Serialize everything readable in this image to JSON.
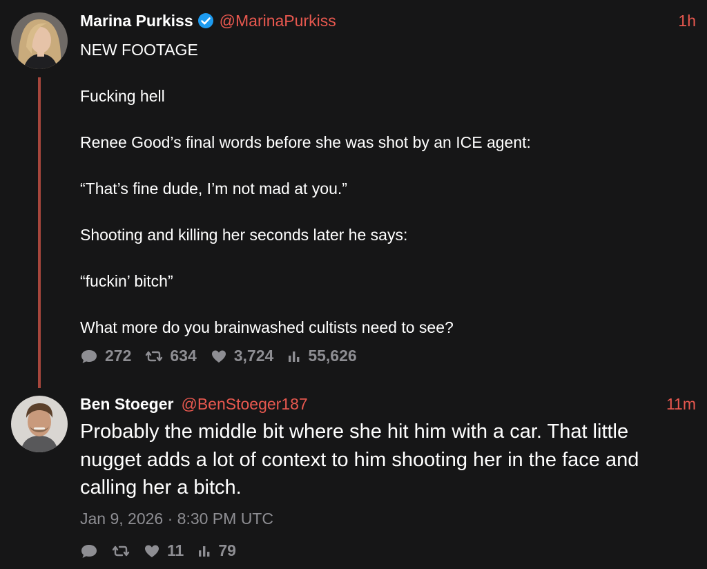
{
  "tweets": [
    {
      "author_name": "Marina Purkiss",
      "handle": "@MarinaPurkiss",
      "time": "1h",
      "verified": true,
      "paragraphs": [
        "NEW FOOTAGE",
        "Fucking hell",
        "Renee Good’s final words before she was shot by an ICE agent:",
        "“That’s fine dude, I’m not mad at you.”",
        "Shooting and killing her seconds later he says:",
        "“fuckin’ bitch”",
        "What more do you brainwashed cultists need to see?"
      ],
      "stats": {
        "replies": "272",
        "retweets": "634",
        "likes": "3,724",
        "views": "55,626"
      }
    },
    {
      "author_name": "Ben Stoeger",
      "handle": "@BenStoeger187",
      "time": "11m",
      "verified": false,
      "text": "Probably the middle bit where she hit him with a car. That little nugget adds a lot of context to him shooting her in the face and calling her a bitch.",
      "date": "Jan 9, 2026 · 8:30 PM UTC",
      "stats": {
        "replies": "",
        "retweets": "",
        "likes": "11",
        "views": "79"
      }
    }
  ],
  "colors": {
    "background": "#161617",
    "accent": "#e8584f",
    "thread_line": "#a6463c",
    "muted": "#8e8e93",
    "verified": "#1d9bf0"
  },
  "icons": {
    "reply": "speech-bubble-icon",
    "retweet": "retweet-icon",
    "like": "heart-icon",
    "views": "bar-chart-icon",
    "verified": "verified-badge-icon"
  }
}
